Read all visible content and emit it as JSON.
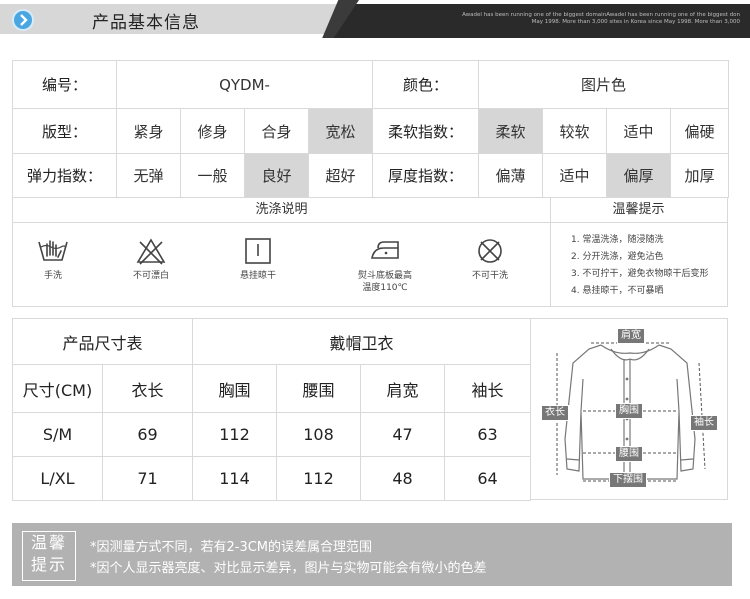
{
  "header": {
    "title": "产品基本信息",
    "english_lines": [
      "Awadel has been running one of the biggest domainAwadel has been running one of the biggest don",
      "May 1998. More than 3,000 sites in Korea since May 1998. More than 3,000"
    ]
  },
  "info": {
    "code_label": "编号：",
    "code_value": "QYDM-",
    "color_label": "颜色：",
    "color_value": "图片色",
    "fit_label": "版型：",
    "fit_options": [
      "紧身",
      "修身",
      "合身",
      "宽松"
    ],
    "fit_selected": "宽松",
    "softness_label": "柔软指数：",
    "softness_options": [
      "柔软",
      "较软",
      "适中",
      "偏硬"
    ],
    "softness_selected": "柔软",
    "elastic_label": "弹力指数：",
    "elastic_options": [
      "无弹",
      "一般",
      "良好",
      "超好"
    ],
    "elastic_selected": "良好",
    "thickness_label": "厚度指数：",
    "thickness_options": [
      "偏薄",
      "适中",
      "偏厚",
      "加厚"
    ],
    "thickness_selected": "偏厚"
  },
  "wash": {
    "title": "洗涤说明",
    "tips_title": "温馨提示",
    "icons": [
      {
        "icon": "hand-wash-icon",
        "label": "手洗"
      },
      {
        "icon": "no-bleach-icon",
        "label": "不可漂白"
      },
      {
        "icon": "hang-dry-icon",
        "label": "悬挂晾干"
      },
      {
        "icon": "iron-icon",
        "label": "熨斗底板最高温度110℃"
      },
      {
        "icon": "no-tumble-dry-icon",
        "label": "不可干洗"
      }
    ],
    "iron_label_line1": "熨斗底板最高",
    "iron_label_line2": "温度110℃",
    "tips": [
      "1. 常温洗涤，随浸随洗",
      "2. 分开洗涤，避免沾色",
      "3. 不可拧干，避免衣物晾干后变形",
      "4. 悬挂晾干，不可暴晒"
    ]
  },
  "size_table": {
    "title": "产品尺寸表",
    "product": "戴帽卫衣",
    "headers": [
      "尺寸(CM)",
      "衣长",
      "胸围",
      "腰围",
      "肩宽",
      "袖长"
    ],
    "rows": [
      [
        "S/M",
        "69",
        "112",
        "108",
        "47",
        "63"
      ],
      [
        "L/XL",
        "71",
        "114",
        "112",
        "48",
        "64"
      ]
    ]
  },
  "diagram": {
    "labels": {
      "shoulder": "肩宽",
      "length": "衣长",
      "chest": "胸围",
      "sleeve": "袖长",
      "waist": "腰围",
      "hem": "下摆围"
    }
  },
  "notice": {
    "badge_line1": "温馨",
    "badge_line2": "提示",
    "line1": "*因测量方式不同，若有2-3CM的误差属合理范围",
    "line2": "*因个人显示器亮度、对比显示差异，图片与实物可能会有微小的色差"
  },
  "colors": {
    "selected_bg": "#d6d6d6",
    "border": "#d9d9d9",
    "notice_bg": "#b2b2b2",
    "banner_dark": "#2a2a2a",
    "accent_blue": "#4aa6e0"
  }
}
